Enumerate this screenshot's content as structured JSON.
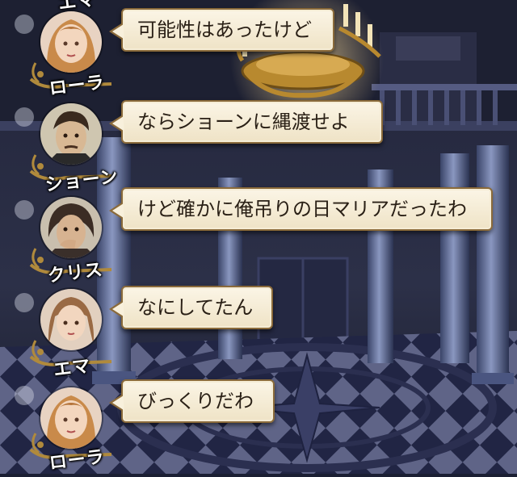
{
  "chat": {
    "top_partial_name": "エマ",
    "messages": [
      {
        "speaker": "ローラ",
        "text": "可能性はあったけど",
        "avatar": "laura-portrait"
      },
      {
        "speaker": "ショーン",
        "text": "ならショーンに縄渡せよ",
        "avatar": "sean-portrait"
      },
      {
        "speaker": "クリス",
        "text": "けど確かに俺吊りの日マリアだったわ",
        "avatar": "chris-portrait"
      },
      {
        "speaker": "エマ",
        "text": "なにしてたん",
        "avatar": "emma-portrait"
      },
      {
        "speaker": "ローラ",
        "text": "びっくりだわ",
        "avatar": "laura-portrait"
      }
    ]
  },
  "colors": {
    "bubble_bg": "#fbf5e6",
    "bubble_border": "#8a6a3a",
    "frame_gold": "#b08a3c",
    "floor_dark": "#1f2440",
    "floor_light": "#6e7396"
  }
}
